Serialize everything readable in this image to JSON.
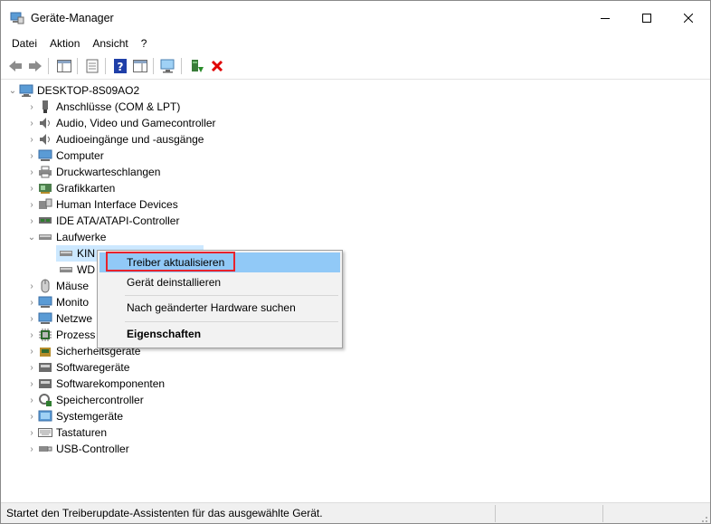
{
  "window": {
    "title": "Geräte-Manager"
  },
  "menu": [
    "Datei",
    "Aktion",
    "Ansicht",
    "?"
  ],
  "tree": {
    "root": "DESKTOP-8S09AO2",
    "categories": [
      {
        "label": "Anschlüsse (COM & LPT)",
        "icon": "port-icon"
      },
      {
        "label": "Audio, Video und Gamecontroller",
        "icon": "speaker-icon"
      },
      {
        "label": "Audioeingänge und -ausgänge",
        "icon": "speaker-icon"
      },
      {
        "label": "Computer",
        "icon": "monitor-icon"
      },
      {
        "label": "Druckwarteschlangen",
        "icon": "printer-icon"
      },
      {
        "label": "Grafikkarten",
        "icon": "display-adapter-icon"
      },
      {
        "label": "Human Interface Devices",
        "icon": "hid-icon"
      },
      {
        "label": "IDE ATA/ATAPI-Controller",
        "icon": "ide-controller-icon"
      },
      {
        "label": "Laufwerke",
        "icon": "disk-drive-icon",
        "expanded": true
      },
      {
        "label": "Mäuse",
        "icon": "mouse-icon"
      },
      {
        "label": "Monito",
        "icon": "monitor-icon"
      },
      {
        "label": "Netzwe",
        "icon": "network-icon"
      },
      {
        "label": "Prozess",
        "icon": "processor-icon"
      },
      {
        "label": "Sicherheitsgeräte",
        "icon": "security-device-icon"
      },
      {
        "label": "Softwaregeräte",
        "icon": "software-device-icon"
      },
      {
        "label": "Softwarekomponenten",
        "icon": "software-component-icon"
      },
      {
        "label": "Speichercontroller",
        "icon": "storage-controller-icon"
      },
      {
        "label": "Systemgeräte",
        "icon": "system-device-icon"
      },
      {
        "label": "Tastaturen",
        "icon": "keyboard-icon"
      },
      {
        "label": "USB-Controller",
        "icon": "usb-icon"
      }
    ],
    "drives": [
      {
        "label": "KIN",
        "selected": true
      },
      {
        "label": "WD",
        "selected": false
      }
    ]
  },
  "context_menu": {
    "items": [
      "Treiber aktualisieren",
      "Gerät deinstallieren",
      "Nach geänderter Hardware suchen",
      "Eigenschaften"
    ],
    "highlighted": "Treiber aktualisieren"
  },
  "status": {
    "text": "Startet den Treiberupdate-Assistenten für das ausgewählte Gerät."
  },
  "colors": {
    "selection": "#cce8ff",
    "menu_highlight": "#91c9f7",
    "annotation_box": "#e8222c",
    "remove_red": "#e00000",
    "help_blue": "#1f3fa8"
  }
}
